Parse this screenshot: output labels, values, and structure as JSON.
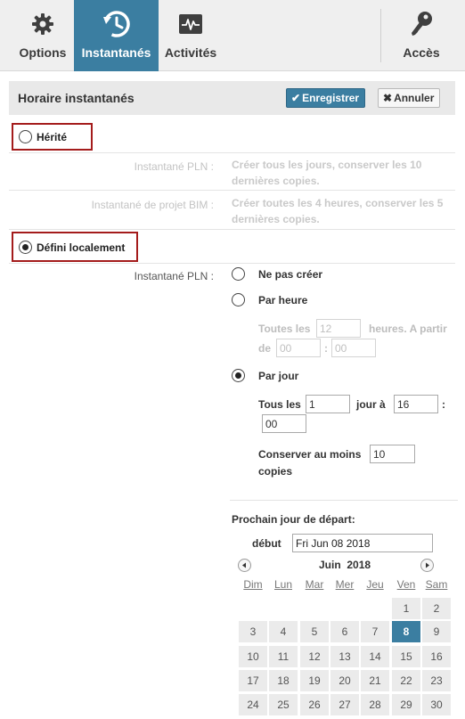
{
  "tabs": [
    {
      "label": "Options",
      "icon": "gear-icon",
      "active": false
    },
    {
      "label": "Instantanés",
      "icon": "snapshot-restore-icon",
      "active": true
    },
    {
      "label": "Activités",
      "icon": "activity-pulse-icon",
      "active": false
    },
    {
      "label": "Accès",
      "icon": "key-icon",
      "active": false
    }
  ],
  "header": {
    "title": "Horaire instantanés",
    "save_label": "Enregistrer",
    "cancel_label": "Annuler"
  },
  "inherited": {
    "label": "Hérité",
    "selected": false,
    "rows": [
      {
        "label": "Instantané PLN :",
        "value": "Créer tous les jours, conserver les 10 dernières copies."
      },
      {
        "label": "Instantané de projet BIM :",
        "value": "Créer toutes les 4 heures, conserver les 5 dernières copies."
      }
    ]
  },
  "local": {
    "label": "Défini localement",
    "selected": true,
    "row_label": "Instantané PLN :",
    "options": {
      "none": {
        "label": "Ne pas créer",
        "selected": false
      },
      "hourly": {
        "label": "Par heure",
        "selected": false,
        "every_prefix": "Toutes les",
        "every_value": "12",
        "every_suffix": "heures. A partir",
        "from_label": "de",
        "start_hour": "00",
        "time_sep": ":",
        "start_minute": "00"
      },
      "daily": {
        "label": "Par jour",
        "selected": true,
        "every_prefix": "Tous les",
        "every_value": "1",
        "at_label": "jour à",
        "hour_value": "16",
        "time_sep": ":",
        "minute_value": "00"
      }
    },
    "keep_label_1": "Conserver au moins",
    "keep_label_2": "copies",
    "keep_value": "10"
  },
  "next_start": {
    "title": "Prochain jour de départ:",
    "start_label": "début",
    "start_value": "Fri Jun 08 2018"
  },
  "calendar": {
    "month": "Juin",
    "year": "2018",
    "prev_icon": "chevron-left-icon",
    "next_icon": "chevron-right-icon",
    "weekdays": [
      "Dim",
      "Lun",
      "Mar",
      "Mer",
      "Jeu",
      "Ven",
      "Sam"
    ],
    "weeks": [
      [
        "",
        "",
        "",
        "",
        "",
        "1",
        "2"
      ],
      [
        "3",
        "4",
        "5",
        "6",
        "7",
        "8",
        "9"
      ],
      [
        "10",
        "11",
        "12",
        "13",
        "14",
        "15",
        "16"
      ],
      [
        "17",
        "18",
        "19",
        "20",
        "21",
        "22",
        "23"
      ],
      [
        "24",
        "25",
        "26",
        "27",
        "28",
        "29",
        "30"
      ]
    ],
    "selected_day": "8"
  },
  "colors": {
    "accent": "#3b7ea1",
    "highlight_border": "#a41c1c",
    "tab_bar_bg": "#efefef"
  }
}
